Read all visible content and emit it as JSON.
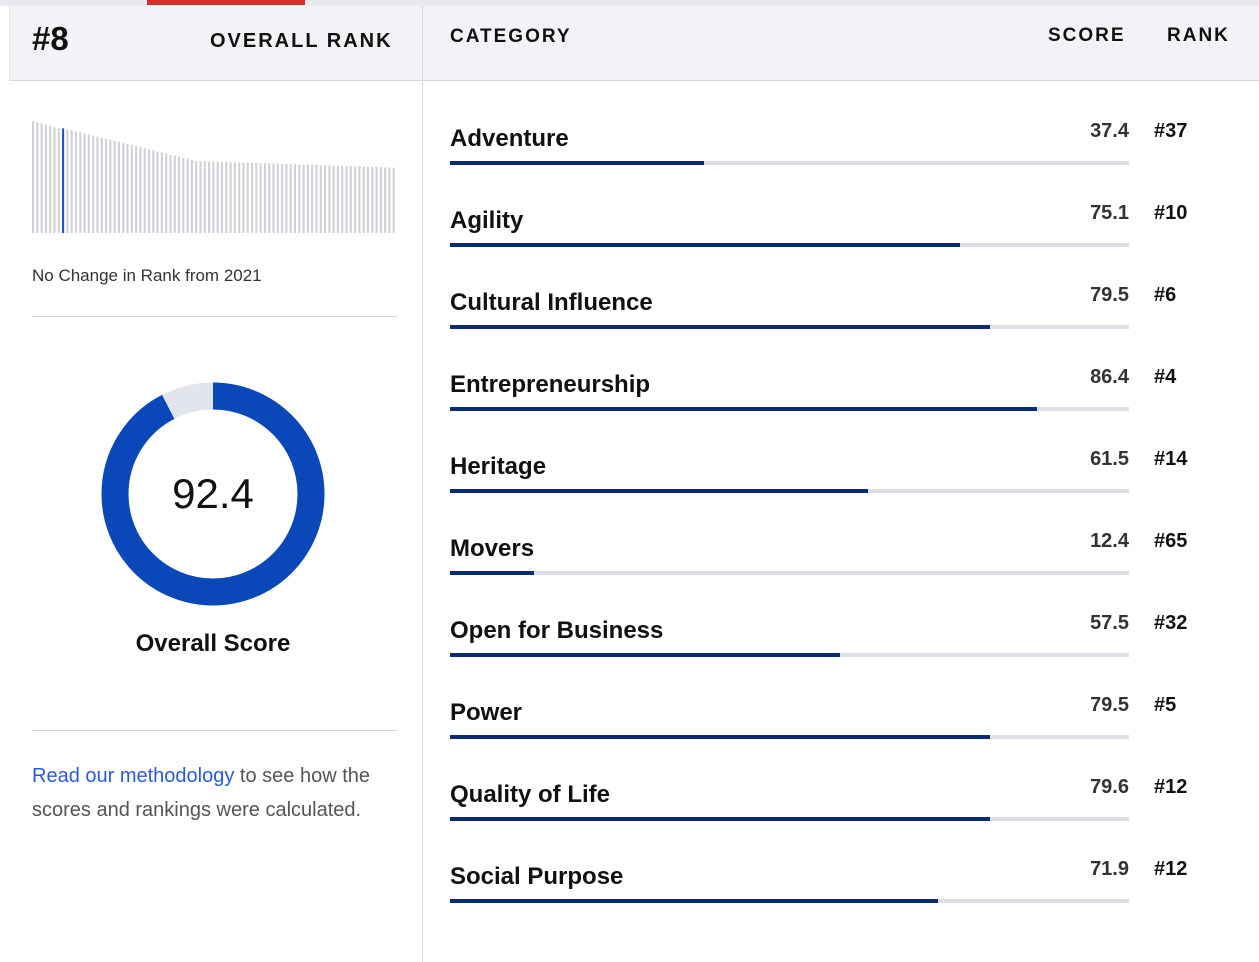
{
  "overall": {
    "rank": "#8",
    "rank_label": "OVERALL RANK",
    "rank_change": "No Change in Rank from 2021",
    "score": 92.4,
    "score_display": "92.4",
    "score_label": "Overall Score",
    "ring_color": "#0a47b8",
    "ring_track_color": "#e2e5ec"
  },
  "rank_histogram": {
    "bar_count": 85,
    "highlight_index": 7,
    "highlight_color": "#1f54c6",
    "bar_color": "#cfd1d7"
  },
  "methodology": {
    "link_text": "Read our methodology",
    "rest_text": " to see how the scores and rankings were calculated."
  },
  "table": {
    "header_category": "CATEGORY",
    "header_score": "SCORE",
    "header_rank": "RANK",
    "rows": [
      {
        "category": "Adventure",
        "score": "37.4",
        "rank": "#37",
        "fill": 0.374
      },
      {
        "category": "Agility",
        "score": "75.1",
        "rank": "#10",
        "fill": 0.751
      },
      {
        "category": "Cultural Influence",
        "score": "79.5",
        "rank": "#6",
        "fill": 0.795
      },
      {
        "category": "Entrepreneurship",
        "score": "86.4",
        "rank": "#4",
        "fill": 0.864
      },
      {
        "category": "Heritage",
        "score": "61.5",
        "rank": "#14",
        "fill": 0.615
      },
      {
        "category": "Movers",
        "score": "12.4",
        "rank": "#65",
        "fill": 0.124
      },
      {
        "category": "Open for Business",
        "score": "57.5",
        "rank": "#32",
        "fill": 0.575
      },
      {
        "category": "Power",
        "score": "79.5",
        "rank": "#5",
        "fill": 0.795
      },
      {
        "category": "Quality of Life",
        "score": "79.6",
        "rank": "#12",
        "fill": 0.796
      },
      {
        "category": "Social Purpose",
        "score": "71.9",
        "rank": "#12",
        "fill": 0.719
      }
    ]
  },
  "colors": {
    "bar_fill": "#0b2a6f",
    "bar_track": "#dcdee3",
    "link": "#2a5bd7",
    "header_bg": "#f2f3f6"
  }
}
